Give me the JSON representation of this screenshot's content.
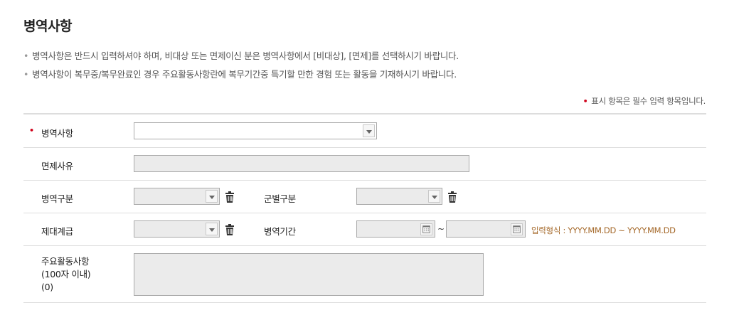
{
  "section_title": "병역사항",
  "notes": [
    "병역사항은 반드시 입력하셔야 하며, 비대상 또는 면제이신 분은 병역사항에서 [비대상], [면제]를 선택하시기 바랍니다.",
    "병역사항이 복무중/복무완료인 경우 주요활동사항란에 복무기간중 특기할 만한 경험 또는 활동을 기재하시기 바랍니다."
  ],
  "required_legend": "표시 항목은 필수 입력 항목입니다.",
  "required_marker": "•",
  "colors": {
    "required": "#d0021b",
    "format_hint": "#a5692a"
  },
  "fields": {
    "military_status": {
      "label": "병역사항",
      "value": ""
    },
    "exemption_reason": {
      "label": "면제사유",
      "value": ""
    },
    "service_type": {
      "label": "병역구분",
      "value": ""
    },
    "branch": {
      "label": "군별구분",
      "value": ""
    },
    "discharge_rank": {
      "label": "제대계급",
      "value": ""
    },
    "service_period": {
      "label": "병역기간",
      "from": "",
      "to": "",
      "separator": "~",
      "format_hint": "입력형식 : YYYY.MM.DD ~ YYYY.MM.DD"
    },
    "activities": {
      "label_line1": "주요활동사항",
      "label_line2": "(100자 이내)",
      "label_line3": "(0)",
      "value": ""
    }
  }
}
